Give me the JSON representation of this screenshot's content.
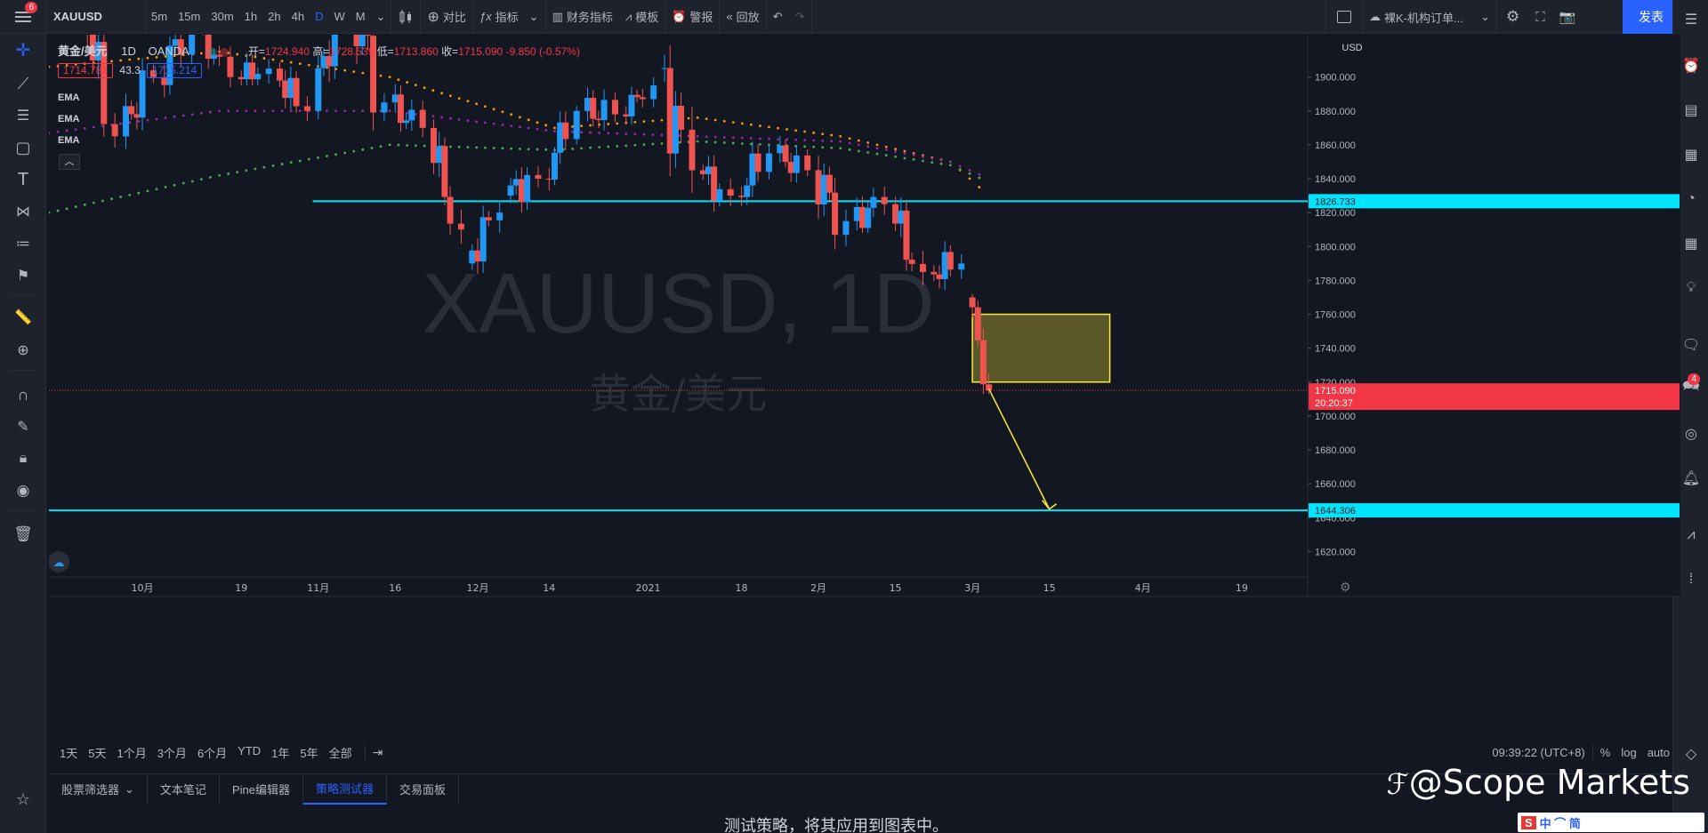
{
  "topbar": {
    "menu_badge": "6",
    "symbol": "XAUUSD",
    "intervals": [
      "5m",
      "15m",
      "30m",
      "1h",
      "2h",
      "4h",
      "D",
      "W",
      "M"
    ],
    "active_interval": "D",
    "compare": "对比",
    "indicators": "指标",
    "financials": "财务指标",
    "templates": "模板",
    "alerts": "警报",
    "replay": "回放",
    "layout_name": "裸K-机构订单...",
    "publish": "发表"
  },
  "legend": {
    "title": "黄金/美元",
    "interval": "1D",
    "source": "OANDA",
    "open_label": "开=",
    "open": "1724.940",
    "high_label": "高=",
    "high": "1728.539",
    "low_label": "低=",
    "low": "1713.860",
    "close_label": "收=",
    "close": "1715.090",
    "change": "-9.850 (-0.57%)",
    "bid": "1714.781",
    "spread": "43.3",
    "ask": "1715.214",
    "ema_labels": [
      "EMA",
      "EMA",
      "EMA"
    ]
  },
  "watermark": {
    "symbol": "XAUUSD, 1D",
    "name": "黄金/美元"
  },
  "price_axis": {
    "currency": "USD",
    "ticks": [
      "1900.000",
      "1880.000",
      "1860.000",
      "1840.000",
      "1820.000",
      "1800.000",
      "1780.000",
      "1760.000",
      "1740.000",
      "1720.000",
      "1700.000",
      "1680.000",
      "1660.000",
      "1640.000",
      "1620.000"
    ],
    "current_price": "1715.090",
    "countdown": "20:20:37",
    "line1_label": "1826.733",
    "line2_label": "1644.306"
  },
  "time_axis": {
    "labels": [
      "10月",
      "19",
      "11月",
      "16",
      "12月",
      "14",
      "2021",
      "18",
      "2月",
      "15",
      "3月",
      "15",
      "4月",
      "19"
    ]
  },
  "bottombar": {
    "ranges": [
      "1天",
      "5天",
      "1个月",
      "3个月",
      "6个月",
      "YTD",
      "1年",
      "5年",
      "全部"
    ],
    "clock": "09:39:22 (UTC+8)",
    "percent": "%",
    "log": "log",
    "auto": "auto"
  },
  "panel": {
    "tabs": [
      "股票筛选器",
      "文本笔记",
      "Pine编辑器",
      "策略测试器",
      "交易面板"
    ],
    "active_tab": "策略测试器",
    "message": "测试策略，将其应用到图表中。"
  },
  "right_sidebar": {
    "chat_badge": "4"
  },
  "brand_watermark": "@Scope Markets",
  "ime_bar": "中 ⌒ 简",
  "colors": {
    "up": "#2196f3",
    "down": "#ef5350",
    "hline": "#00e5ff",
    "zone": "#ffeb3b",
    "accent": "#2962ff"
  },
  "chart_data": {
    "type": "candlestick",
    "symbol": "XAUUSD",
    "interval": "1D",
    "ylim": [
      1605,
      1925
    ],
    "x_range": [
      "2020-09-14",
      "2021-05-01"
    ],
    "horizontal_lines": [
      1826.733,
      1644.306
    ],
    "zone": {
      "start": "2021-03-01",
      "end": "2021-03-26",
      "low": 1720,
      "high": 1760
    },
    "arrow": {
      "from": {
        "date": "2021-03-04",
        "price": 1716
      },
      "to": {
        "date": "2021-03-15",
        "price": 1645
      }
    },
    "candles": [
      {
        "d": "2020-09-14",
        "o": 1930,
        "h": 1966,
        "l": 1912,
        "c": 1955
      },
      {
        "d": "2020-09-21",
        "o": 1955,
        "h": 1960,
        "l": 1850,
        "c": 1865
      },
      {
        "d": "2020-09-28",
        "o": 1865,
        "h": 1915,
        "l": 1848,
        "c": 1900
      },
      {
        "d": "2020-10-05",
        "o": 1900,
        "h": 1935,
        "l": 1875,
        "c": 1930
      },
      {
        "d": "2020-10-12",
        "o": 1930,
        "h": 1933,
        "l": 1890,
        "c": 1900
      },
      {
        "d": "2020-10-19",
        "o": 1900,
        "h": 1932,
        "l": 1895,
        "c": 1905
      },
      {
        "d": "2020-10-26",
        "o": 1905,
        "h": 1915,
        "l": 1860,
        "c": 1880
      },
      {
        "d": "2020-11-02",
        "o": 1880,
        "h": 1965,
        "l": 1875,
        "c": 1950
      },
      {
        "d": "2020-11-09",
        "o": 1950,
        "h": 1958,
        "l": 1850,
        "c": 1885
      },
      {
        "d": "2020-11-16",
        "o": 1885,
        "h": 1900,
        "l": 1855,
        "c": 1870
      },
      {
        "d": "2020-11-23",
        "o": 1870,
        "h": 1875,
        "l": 1800,
        "c": 1810
      },
      {
        "d": "2020-11-30",
        "o": 1790,
        "h": 1830,
        "l": 1765,
        "c": 1820
      },
      {
        "d": "2020-12-07",
        "o": 1830,
        "h": 1875,
        "l": 1820,
        "c": 1840
      },
      {
        "d": "2020-12-14",
        "o": 1840,
        "h": 1885,
        "l": 1828,
        "c": 1880
      },
      {
        "d": "2020-12-21",
        "o": 1880,
        "h": 1905,
        "l": 1860,
        "c": 1878
      },
      {
        "d": "2020-12-28",
        "o": 1878,
        "h": 1900,
        "l": 1870,
        "c": 1895
      },
      {
        "d": "2021-01-04",
        "o": 1905,
        "h": 1960,
        "l": 1815,
        "c": 1845
      },
      {
        "d": "2021-01-11",
        "o": 1845,
        "h": 1865,
        "l": 1810,
        "c": 1830
      },
      {
        "d": "2021-01-18",
        "o": 1830,
        "h": 1875,
        "l": 1820,
        "c": 1855
      },
      {
        "d": "2021-01-25",
        "o": 1855,
        "h": 1870,
        "l": 1830,
        "c": 1845
      },
      {
        "d": "2021-02-01",
        "o": 1845,
        "h": 1870,
        "l": 1790,
        "c": 1815
      },
      {
        "d": "2021-02-08",
        "o": 1815,
        "h": 1855,
        "l": 1808,
        "c": 1825
      },
      {
        "d": "2021-02-15",
        "o": 1825,
        "h": 1830,
        "l": 1760,
        "c": 1785
      },
      {
        "d": "2021-02-22",
        "o": 1785,
        "h": 1815,
        "l": 1765,
        "c": 1790
      },
      {
        "d": "2021-03-01",
        "o": 1770,
        "h": 1772,
        "l": 1713,
        "c": 1715
      }
    ]
  }
}
